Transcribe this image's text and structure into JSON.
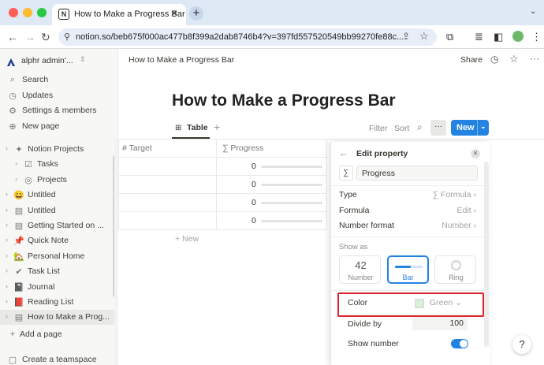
{
  "browser": {
    "tab_title": "How to Make a Progress Bar",
    "url": "notion.so/beb675f000ac477b8f399a2dab8746b4?v=397fd557520549bb99270fe88c...",
    "new_tab_symbol": "+",
    "close_symbol": "✕",
    "traffic_colors": [
      "#fe5f57",
      "#febc2e",
      "#28c840"
    ]
  },
  "sidebar": {
    "workspace": "alphr admin'...",
    "actions": [
      {
        "icon": "search-icon",
        "glyph": "⌕",
        "label": "Search"
      },
      {
        "icon": "clock-icon",
        "glyph": "◷",
        "label": "Updates"
      },
      {
        "icon": "gear-icon",
        "glyph": "⚙",
        "label": "Settings & members"
      },
      {
        "icon": "plus-circle-icon",
        "glyph": "⊕",
        "label": "New page"
      }
    ],
    "pages": [
      {
        "label": "Notion Projects",
        "glyph": "✦",
        "indent": 0
      },
      {
        "label": "Tasks",
        "glyph": "☑",
        "indent": 1
      },
      {
        "label": "Projects",
        "glyph": "◎",
        "indent": 1
      },
      {
        "label": "Untitled",
        "glyph": "😀",
        "indent": 0
      },
      {
        "label": "Untitled",
        "glyph": "▤",
        "indent": 0
      },
      {
        "label": "Getting Started on ...",
        "glyph": "▤",
        "indent": 0
      },
      {
        "label": "Quick Note",
        "glyph": "📌",
        "indent": 0
      },
      {
        "label": "Personal Home",
        "glyph": "🏡",
        "indent": 0
      },
      {
        "label": "Task List",
        "glyph": "✔",
        "indent": 0
      },
      {
        "label": "Journal",
        "glyph": "📓",
        "indent": 0
      },
      {
        "label": "Reading List",
        "glyph": "📕",
        "indent": 0
      },
      {
        "label": "How to Make a Prog...",
        "glyph": "▤",
        "indent": 0
      }
    ],
    "add_page": "Add a page",
    "create_teamspace": "Create a teamspace"
  },
  "topbar": {
    "breadcrumb": "How to Make a Progress Bar",
    "share": "Share"
  },
  "page": {
    "title": "How to Make a Progress Bar",
    "view_tab": "Table",
    "filter": "Filter",
    "sort": "Sort",
    "more": "···",
    "new_button": "New",
    "columns": [
      "# Target",
      "∑  Progress"
    ],
    "rows": [
      {
        "progress": "0"
      },
      {
        "progress": "0"
      },
      {
        "progress": "0"
      },
      {
        "progress": "0"
      }
    ],
    "new_row": "+  New"
  },
  "panel": {
    "header": "Edit property",
    "name_value": "Progress",
    "type_label": "Type",
    "type_value": "∑ Formula",
    "formula_label": "Formula",
    "formula_value": "Edit",
    "number_format_label": "Number format",
    "number_format_value": "Number",
    "show_as_label": "Show as",
    "show_as_options": [
      {
        "label": "Number",
        "preview": "42",
        "selected": false
      },
      {
        "label": "Bar",
        "preview": "",
        "selected": true
      },
      {
        "label": "Ring",
        "preview": "",
        "selected": false
      }
    ],
    "color_label": "Color",
    "color_value": "Green",
    "color_swatch": "#dbeddb",
    "divide_by_label": "Divide by",
    "divide_by_value": "100",
    "show_number_label": "Show number",
    "show_number_on": true,
    "accent": "#2383e2",
    "highlight_color": "#e0212b"
  },
  "help": "?"
}
